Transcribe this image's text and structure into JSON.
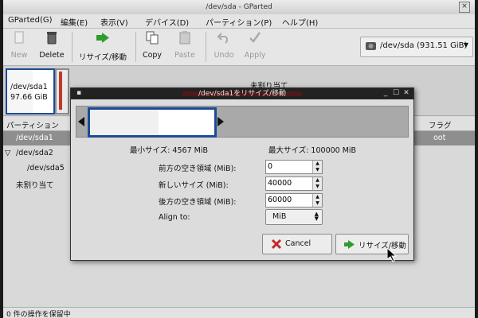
{
  "window": {
    "title": "/dev/sda - GParted",
    "close_glyph": "×"
  },
  "menubar": [
    "GParted(G)",
    "編集(E)",
    "表示(V)",
    "デバイス(D)",
    "パーティション(P)",
    "ヘルプ(H)"
  ],
  "toolbar": {
    "new": "New",
    "delete": "Delete",
    "resize": "リサイズ/移動",
    "copy": "Copy",
    "paste": "Paste",
    "undo": "Undo",
    "apply": "Apply",
    "device": "/dev/sda   (931.51 GiB)",
    "device_arrow": "▼"
  },
  "disk_map": {
    "sda1_name": "/dev/sda1",
    "sda1_size": "97.66 GiB",
    "sda1_used_fraction": 0.55,
    "unallocated": "未割り当て"
  },
  "list": {
    "col_partition": "パーティション",
    "col_flags": "フラグ",
    "flags_partial": "oot",
    "rows": [
      {
        "name": "/dev/sda1",
        "expander": ""
      },
      {
        "name": "/dev/sda2",
        "expander": "▽"
      },
      {
        "name": "/dev/sda5",
        "expander": ""
      },
      {
        "name": "未割り当て",
        "expander": ""
      }
    ]
  },
  "status": {
    "text": "0 件の操作を保留中"
  },
  "dialog": {
    "title": "/dev/sda1をリサイズ/移動",
    "title_buttons": [
      "_",
      "☐",
      "✕"
    ],
    "min_size": "最小サイズ:  4567  MiB",
    "max_size": "最大サイズ:  100000  MiB",
    "partition_fraction": 0.4,
    "used_fraction": 0.55,
    "free_before_label": "前方の空き領域  (MiB):",
    "free_before_value": "0",
    "new_size_label": "新しいサイズ  (MiB):",
    "new_size_value": "40000",
    "free_after_label": "後方の空き領域  (MiB):",
    "free_after_value": "60000",
    "align_label": "Align to:",
    "align_value": "MiB",
    "spin_up": "▲",
    "spin_down": "▼",
    "cancel_label": "Cancel",
    "resize_label": "リサイズ/移動",
    "colon": ":"
  }
}
